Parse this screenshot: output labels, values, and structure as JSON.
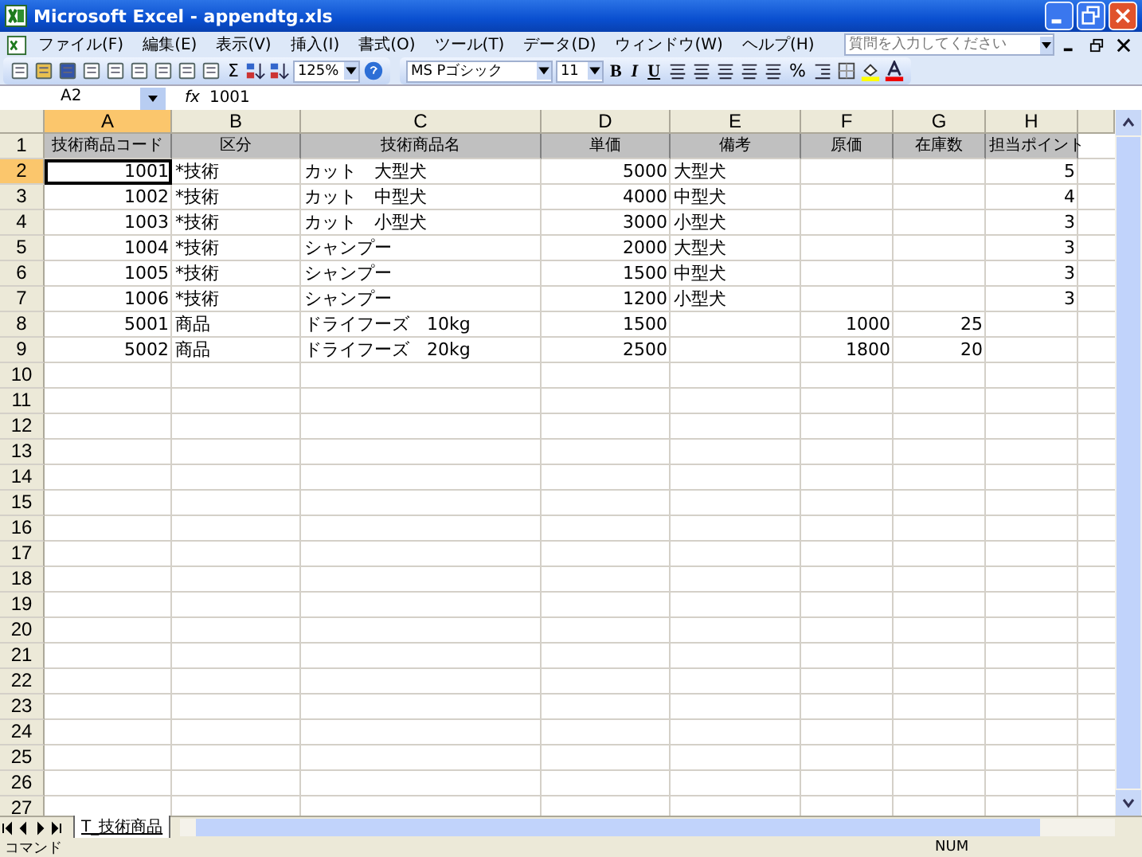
{
  "window": {
    "title": "Microsoft Excel - appendtg.xls"
  },
  "menu": [
    "ファイル(F)",
    "編集(E)",
    "表示(V)",
    "挿入(I)",
    "書式(O)",
    "ツール(T)",
    "データ(D)",
    "ウィンドウ(W)",
    "ヘルプ(H)"
  ],
  "help_search": {
    "placeholder": "質問を入力してください"
  },
  "toolbar": {
    "zoom": "125%",
    "font": "MS Pゴシック",
    "size": "11",
    "sum": "Σ",
    "bold": "B",
    "italic": "I",
    "underline": "U",
    "percent": "%"
  },
  "formula_bar": {
    "name_box": "A2",
    "fx": "fx",
    "value": "1001"
  },
  "columns": [
    {
      "letter": "A",
      "numeric": true,
      "selected": true
    },
    {
      "letter": "B",
      "numeric": false,
      "selected": false
    },
    {
      "letter": "C",
      "numeric": false,
      "selected": false
    },
    {
      "letter": "D",
      "numeric": true,
      "selected": false
    },
    {
      "letter": "E",
      "numeric": false,
      "selected": false
    },
    {
      "letter": "F",
      "numeric": true,
      "selected": false
    },
    {
      "letter": "G",
      "numeric": true,
      "selected": false
    },
    {
      "letter": "H",
      "numeric": true,
      "selected": false
    }
  ],
  "rows": [
    {
      "number": "1",
      "kind": "header",
      "selected": false,
      "cells": {
        "A": "技術商品コード",
        "B": "区分",
        "C": "技術商品名",
        "D": "単価",
        "E": "備考",
        "F": "原価",
        "G": "在庫数",
        "H": "担当ポイント"
      }
    },
    {
      "number": "2",
      "kind": "data",
      "selected": true,
      "cells": {
        "A": "1001",
        "B": "*技術",
        "C": "カット　大型犬",
        "D": "5000",
        "E": "大型犬",
        "H": "5"
      }
    },
    {
      "number": "3",
      "kind": "data",
      "selected": false,
      "cells": {
        "A": "1002",
        "B": "*技術",
        "C": "カット　中型犬",
        "D": "4000",
        "E": "中型犬",
        "H": "4"
      }
    },
    {
      "number": "4",
      "kind": "data",
      "selected": false,
      "cells": {
        "A": "1003",
        "B": "*技術",
        "C": "カット　小型犬",
        "D": "3000",
        "E": "小型犬",
        "H": "3"
      }
    },
    {
      "number": "5",
      "kind": "data",
      "selected": false,
      "cells": {
        "A": "1004",
        "B": "*技術",
        "C": "シャンプー",
        "D": "2000",
        "E": "大型犬",
        "H": "3"
      }
    },
    {
      "number": "6",
      "kind": "data",
      "selected": false,
      "cells": {
        "A": "1005",
        "B": "*技術",
        "C": "シャンプー",
        "D": "1500",
        "E": "中型犬",
        "H": "3"
      }
    },
    {
      "number": "7",
      "kind": "data",
      "selected": false,
      "cells": {
        "A": "1006",
        "B": "*技術",
        "C": "シャンプー",
        "D": "1200",
        "E": "小型犬",
        "H": "3"
      }
    },
    {
      "number": "8",
      "kind": "data",
      "selected": false,
      "cells": {
        "A": "5001",
        "B": "商品",
        "C": "ドライフーズ　10kg",
        "D": "1500",
        "F": "1000",
        "G": "25"
      }
    },
    {
      "number": "9",
      "kind": "data",
      "selected": false,
      "cells": {
        "A": "5002",
        "B": "商品",
        "C": "ドライフーズ　20kg",
        "D": "2500",
        "F": "1800",
        "G": "20"
      }
    },
    {
      "number": "10",
      "kind": "data",
      "selected": false,
      "cells": {}
    },
    {
      "number": "11",
      "kind": "data",
      "selected": false,
      "cells": {}
    },
    {
      "number": "12",
      "kind": "data",
      "selected": false,
      "cells": {}
    },
    {
      "number": "13",
      "kind": "data",
      "selected": false,
      "cells": {}
    },
    {
      "number": "14",
      "kind": "data",
      "selected": false,
      "cells": {}
    },
    {
      "number": "15",
      "kind": "data",
      "selected": false,
      "cells": {}
    },
    {
      "number": "16",
      "kind": "data",
      "selected": false,
      "cells": {}
    },
    {
      "number": "17",
      "kind": "data",
      "selected": false,
      "cells": {}
    },
    {
      "number": "18",
      "kind": "data",
      "selected": false,
      "cells": {}
    },
    {
      "number": "19",
      "kind": "data",
      "selected": false,
      "cells": {}
    },
    {
      "number": "20",
      "kind": "data",
      "selected": false,
      "cells": {}
    },
    {
      "number": "21",
      "kind": "data",
      "selected": false,
      "cells": {}
    },
    {
      "number": "22",
      "kind": "data",
      "selected": false,
      "cells": {}
    },
    {
      "number": "23",
      "kind": "data",
      "selected": false,
      "cells": {}
    },
    {
      "number": "24",
      "kind": "data",
      "selected": false,
      "cells": {}
    },
    {
      "number": "25",
      "kind": "data",
      "selected": false,
      "cells": {}
    },
    {
      "number": "26",
      "kind": "data",
      "selected": false,
      "cells": {}
    },
    {
      "number": "27",
      "kind": "data",
      "selected": false,
      "cells": {}
    }
  ],
  "sheet_tabs": [
    {
      "label": "T_技術商品",
      "selected": true
    }
  ],
  "status_bar": {
    "mode": "コマンド",
    "num": "NUM"
  }
}
